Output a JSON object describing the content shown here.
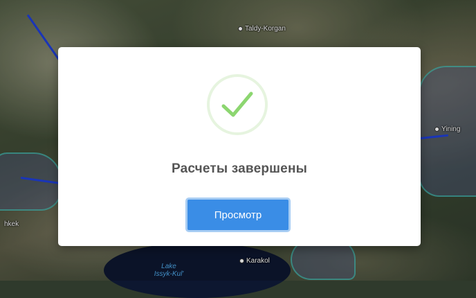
{
  "map": {
    "places": [
      {
        "name": "Taldy-Korgan"
      },
      {
        "name": "Yining"
      },
      {
        "name": "hkek"
      },
      {
        "name": "Karakol"
      }
    ],
    "lake": {
      "line1": "Lake",
      "line2": "Issyk-Kul'"
    }
  },
  "dialog": {
    "icon": "checkmark-icon",
    "title": "Расчеты завершены",
    "button_label": "Просмотр"
  },
  "colors": {
    "accent": "#3a8de6",
    "success": "#8cd670",
    "title_text": "#555555"
  }
}
